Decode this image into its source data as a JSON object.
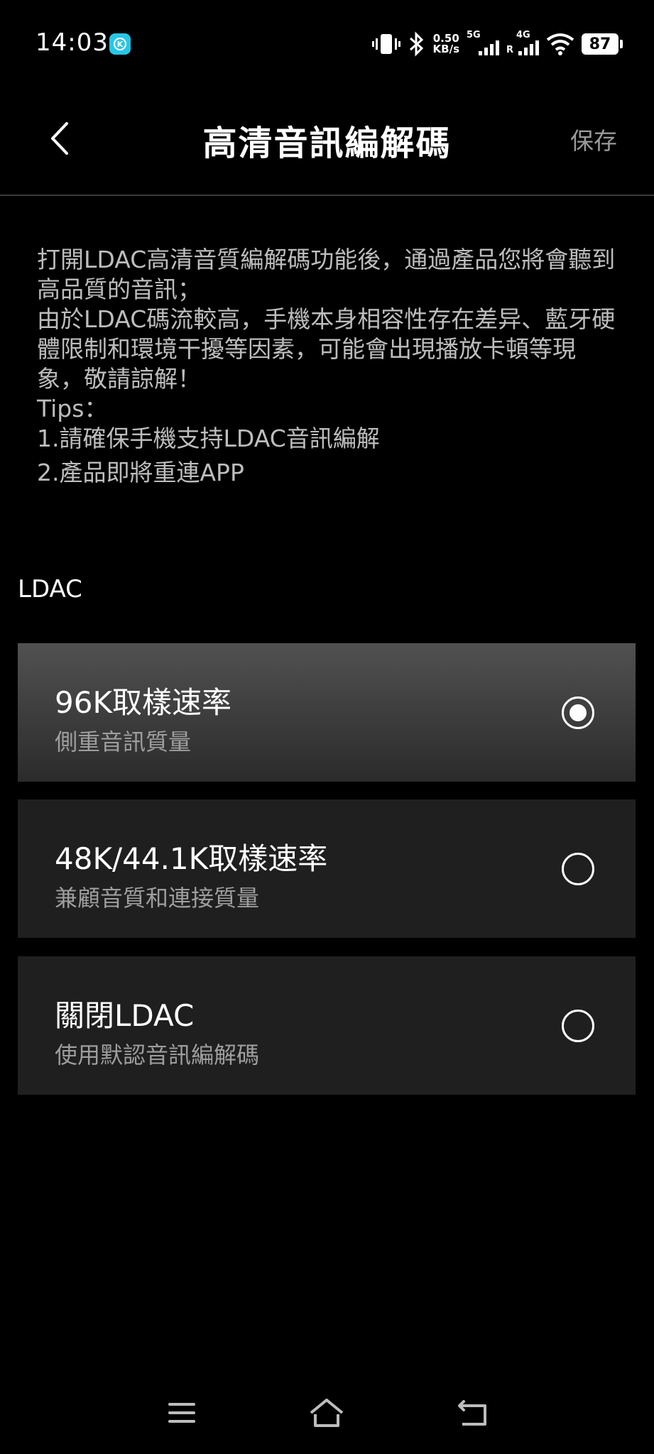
{
  "status": {
    "time": "14:03",
    "net_speed_value": "0.50",
    "net_speed_unit": "KB/s",
    "signal1_label": "5G",
    "signal2_label": "4G",
    "signal2_roaming": "R",
    "battery": "87"
  },
  "header": {
    "title": "高清音訊編解碼",
    "save_label": "保存"
  },
  "description": {
    "line1": "打開LDAC高清音質編解碼功能後，通過產品您將會聽到高品質的音訊；",
    "line2": "由於LDAC碼流較高，手機本身相容性存在差异、藍牙硬體限制和環境干擾等因素，可能會出現播放卡頓等現象，敬請諒解！",
    "tips_label": "Tips：",
    "tip1": "1.請確保手機支持LDAC音訊編解",
    "tip2": "2.產品即將重連APP"
  },
  "section": {
    "title": "LDAC"
  },
  "options": [
    {
      "title": "96K取樣速率",
      "subtitle": "側重音訊質量",
      "selected": true
    },
    {
      "title": "48K/44.1K取樣速率",
      "subtitle": "兼顧音質和連接質量",
      "selected": false
    },
    {
      "title": "關閉LDAC",
      "subtitle": "使用默認音訊編解碼",
      "selected": false
    }
  ],
  "colors": {
    "background": "#000000",
    "card": "#1f1f1f",
    "card_selected": "#4a4a4a",
    "app_badge": "#27c6e6"
  }
}
